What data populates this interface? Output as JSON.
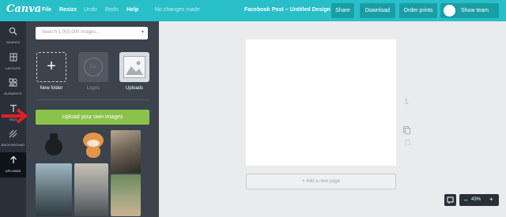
{
  "app": {
    "logo_text": "Canva"
  },
  "menu": {
    "file": "File",
    "resize": "Resize",
    "undo": "Undo",
    "redo": "Redo",
    "help": "Help",
    "status": "No changes made"
  },
  "document": {
    "title": "Facebook Post – Untitled Design"
  },
  "toolbar": {
    "share": "Share",
    "download": "Download",
    "order_prints": "Order prints",
    "show_team": "Show team"
  },
  "rail": {
    "search": "SEARCH",
    "layouts": "LAYOUTS",
    "elements": "ELEMENTS",
    "text": "TEXT",
    "background": "BACKGROUND",
    "uploads": "UPLOADS"
  },
  "panel": {
    "search_placeholder": "Search 1,000,000 images...",
    "folders": {
      "new_folder": "New folder",
      "logos": "Logos",
      "logos_badge": "Co.",
      "uploads": "Uploads"
    },
    "upload_button": "Upload your own images"
  },
  "canvas": {
    "page_number": "1",
    "add_page": "+ Add a new page"
  },
  "zoom": {
    "value": "43%",
    "minus": "–",
    "plus": "+"
  },
  "colors": {
    "topbar": "#28bfc8",
    "upload_button": "#8bc34a",
    "arrow": "#e02222"
  }
}
